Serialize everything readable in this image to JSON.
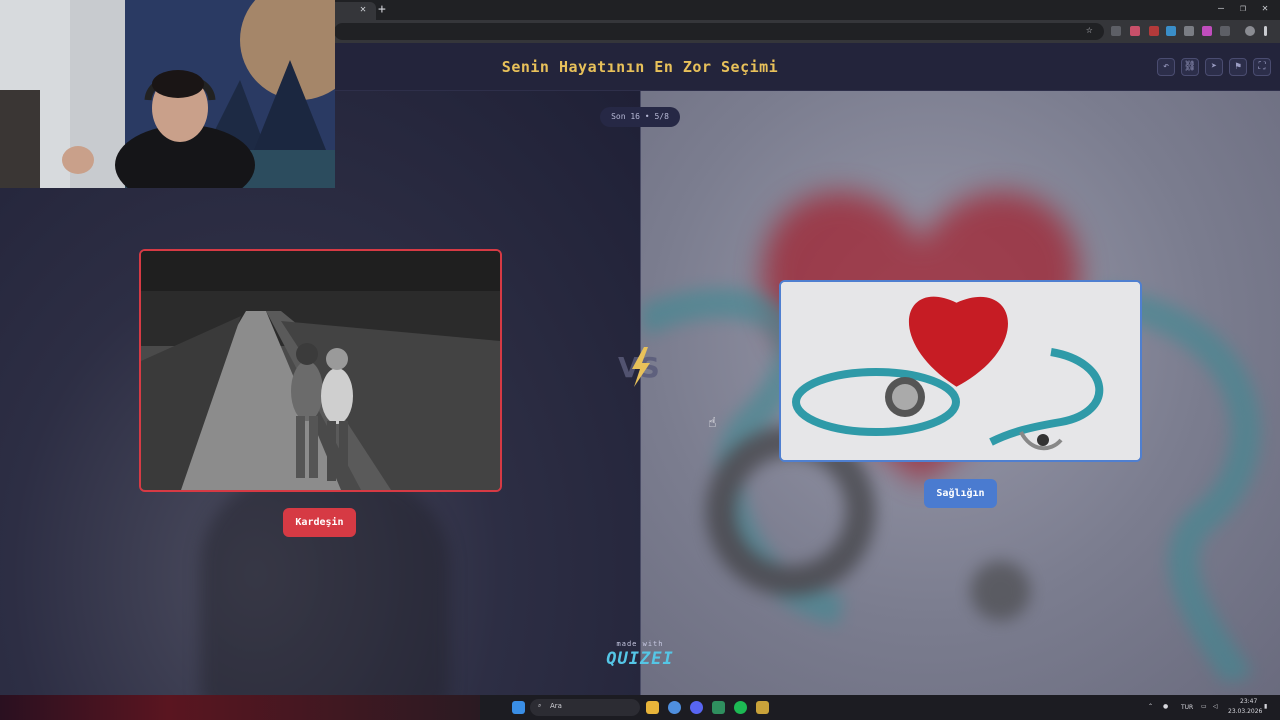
{
  "browser": {
    "tab_title": "",
    "tab_close": "✕",
    "new_tab": "+",
    "window_controls": [
      "—",
      "❐",
      "✕"
    ]
  },
  "header": {
    "title": "Senin Hayatının En Zor Seçimi",
    "buttons": [
      "undo-icon",
      "link-icon",
      "send-icon",
      "flag-icon",
      "fullscreen-icon"
    ]
  },
  "round": {
    "counter": "Son 16 • 5/8"
  },
  "options": {
    "left_label": "Kardeşin",
    "right_label": "Sağlığın"
  },
  "footer": {
    "made_with": "made with",
    "brand": "QUIZEI"
  },
  "taskbar": {
    "search_placeholder": "Ara",
    "language": "TUR",
    "time": "23:47",
    "date": "23.03.2026"
  },
  "colors": {
    "accent_title": "#e8c15a",
    "left_accent": "#d63a44",
    "right_accent": "#4a7bd0",
    "brand": "#55c6e6"
  }
}
